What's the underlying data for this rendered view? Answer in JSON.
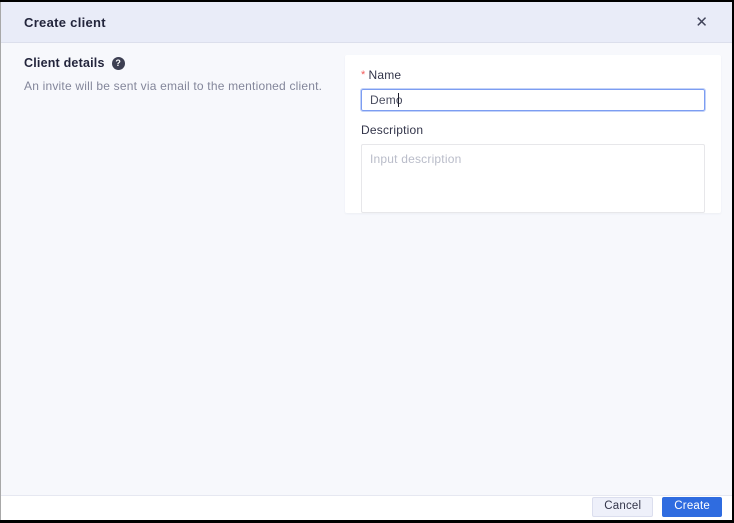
{
  "modal": {
    "title": "Create client",
    "close_icon": "✕"
  },
  "section": {
    "title": "Client details",
    "help_icon": "?",
    "description": "An invite will be sent via email to the mentioned client."
  },
  "form": {
    "name": {
      "label": "Name",
      "required_marker": "*",
      "value": "Demo"
    },
    "description": {
      "label": "Description",
      "placeholder": "Input description"
    }
  },
  "footer": {
    "cancel_label": "Cancel",
    "create_label": "Create"
  },
  "colors": {
    "accent_blue": "#2f6ce0",
    "focus_border_blue": "#7c9df2",
    "required_red": "#f25b5b",
    "header_bg": "#e9ecf8",
    "body_bg": "#f7f8fc"
  }
}
